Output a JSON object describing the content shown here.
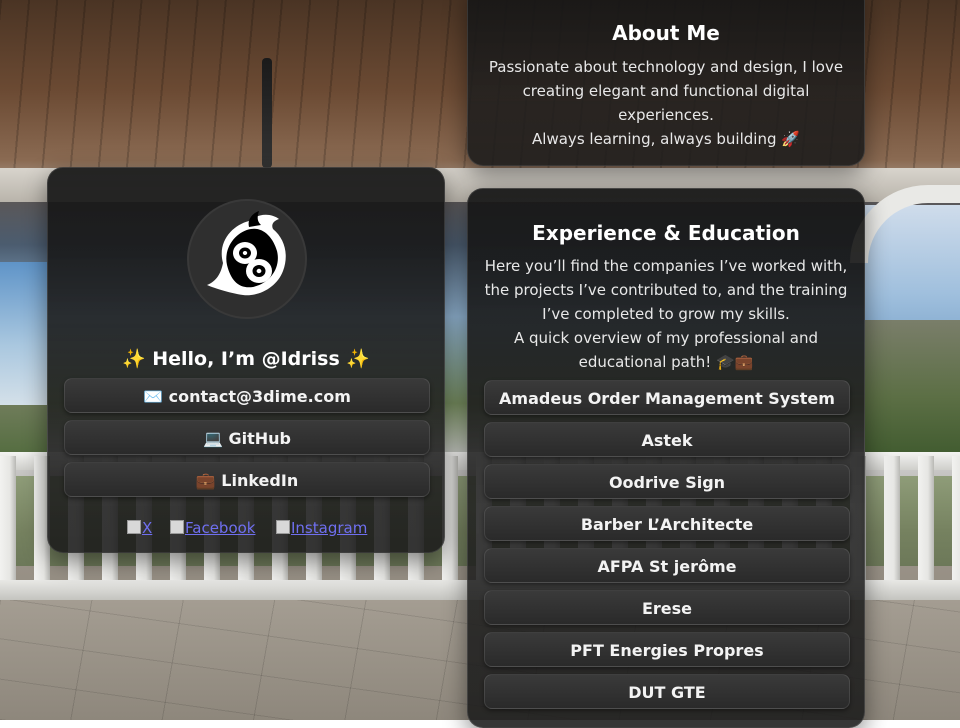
{
  "about": {
    "title": "About Me",
    "line1": "Passionate about technology and design, I love",
    "line2": "creating elegant and functional digital",
    "line3": "experiences.",
    "line4": "Always learning, always building 🚀"
  },
  "profile": {
    "greeting": "✨ Hello, I’m @Idriss ✨",
    "contact_label": "✉️ contact@3dime.com",
    "github_label": "💻 GitHub",
    "linkedin_label": "💼 LinkedIn",
    "social": [
      {
        "label": "X",
        "icon": "x-icon"
      },
      {
        "label": "Facebook",
        "icon": "facebook-icon"
      },
      {
        "label": "Instagram",
        "icon": "instagram-icon"
      }
    ]
  },
  "experience": {
    "title": "Experience & Education",
    "line1": "Here you’ll find the companies I’ve worked with,",
    "line2": "the projects I’ve contributed to, and the training",
    "line3": "I’ve completed to grow my skills.",
    "line4": "A quick overview of my professional and",
    "line5": "educational path! 🎓💼",
    "items": [
      "Amadeus Order Management System",
      "Astek",
      "Oodrive Sign",
      "Barber L’Architecte",
      "AFPA St jerôme",
      "Erese",
      "PFT Energies Propres",
      "DUT GTE"
    ]
  },
  "colors": {
    "card_bg": "#1c1c1c",
    "pill_bg": "#333333",
    "link": "#6f6ff0",
    "text": "#f2f2f2"
  }
}
